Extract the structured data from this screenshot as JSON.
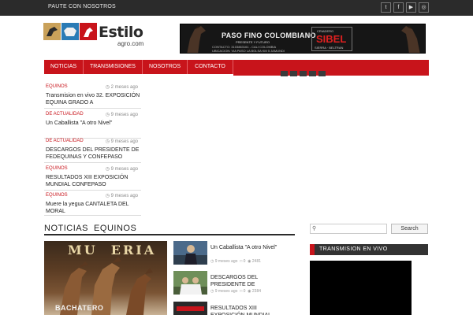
{
  "topbar": {
    "link": "PAUTE CON NOSOTROS",
    "social": [
      {
        "icon": "twitter-icon",
        "glyph": "t"
      },
      {
        "icon": "facebook-icon",
        "glyph": "f"
      },
      {
        "icon": "youtube-icon",
        "glyph": "▶"
      },
      {
        "icon": "instagram-icon",
        "glyph": "◎"
      }
    ]
  },
  "logo": {
    "word": "Estilo",
    "sub": "agro.com"
  },
  "banner": {
    "title": "PASO FINO COLOMBIANO",
    "tagline": "PRESENTE Y FUTURO",
    "contact": "CONTACTO: 3103883161 - CALI COLOMBIA",
    "address": "UBICACION: VIA PASO LA BOLSA KM 5 JAMUNDI",
    "criadero": "CRIADERO",
    "brand": "SIBEL",
    "brand_sub": "SIERRA · BELTRAN"
  },
  "nav": {
    "items": [
      "NOTICIAS",
      "TRANSMISIONES",
      "NOSOTROS",
      "CONTACTO"
    ]
  },
  "news": [
    {
      "category": "EQUINOS",
      "date": "2 meses ago",
      "title": "Transmision en vivo 32. EXPOSICIÓN EQUINA GRADO A"
    },
    {
      "category": "DE ACTUALIDAD",
      "date": "9 meses ago",
      "title": "Un Caballista \"A otro Nivel\""
    },
    {
      "category": "DE ACTUALIDAD",
      "date": "9 meses ago",
      "title": "DESCARGOS DEL PRESIDENTE DE FEDEQUINAS Y CONFEPASO"
    },
    {
      "category": "EQUINOS",
      "date": "9 meses ago",
      "title": "RESULTADOS XIII EXPOSICIÓN MUNDIAL CONFEPASO"
    },
    {
      "category": "EQUINOS",
      "date": "9 meses ago",
      "title": "Muere la yegua CANTALETA DEL MORAL"
    }
  ],
  "section": {
    "title": "NOTICIAS  EQUINOS"
  },
  "feature": {
    "art_title": "MU  ERIA",
    "caption": "BACHATERO"
  },
  "side_news": [
    {
      "title": "Un Caballista \"A otro Nivel\"",
      "date": "9 meses ago",
      "comments": "0",
      "views": "2481"
    },
    {
      "title": "DESCARGOS DEL PRESIDENTE DE",
      "date": "9 meses ago",
      "comments": "0",
      "views": "2384"
    },
    {
      "title": "RESULTADOS XIII EXPOSICIÓN MUNDIAL",
      "date": "",
      "comments": "",
      "views": ""
    }
  ],
  "search": {
    "placeholder": "",
    "button": "Search"
  },
  "live": {
    "title": "TRANSMISION EN VIVO"
  },
  "colors": {
    "accent": "#c8141b",
    "topbar": "#2b2b2b"
  }
}
